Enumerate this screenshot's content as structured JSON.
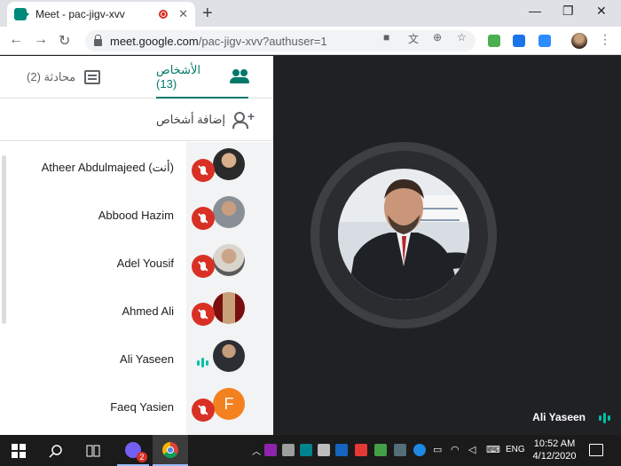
{
  "browser": {
    "tab_title": "Meet - pac-jigv-xvv",
    "tab_close": "✕",
    "new_tab": "+",
    "url_host": "meet.google.com",
    "url_path": "/pac-jigv-xvv?authuser=1",
    "window": {
      "minimize": "—",
      "restore": "❐",
      "close": "✕"
    }
  },
  "panel": {
    "people_tab_label": "الأشخاص (13)",
    "chat_tab_label": "محادثة (2)",
    "add_people_label": "إضافة أشخاص",
    "participants": [
      {
        "name": "Atheer Abdulmajeed (أنت)",
        "mic": "muted"
      },
      {
        "name": "Abbood Hazim",
        "mic": "muted"
      },
      {
        "name": "Adel Yousif",
        "mic": "muted"
      },
      {
        "name": "Ahmed Ali",
        "mic": "muted"
      },
      {
        "name": "Ali Yaseen",
        "mic": "speaking"
      },
      {
        "name": "Faeq Yasien",
        "mic": "muted",
        "initial": "F"
      }
    ]
  },
  "stage": {
    "speaker_name": "Ali Yaseen"
  },
  "taskbar": {
    "time": "10:52 AM",
    "date": "4/12/2020",
    "language": "ENG",
    "notification_badge": "2"
  },
  "colors": {
    "accent": "#00796b",
    "mute_red": "#d93025",
    "speaking_teal": "#00bfa5",
    "stage_bg": "#202124"
  }
}
